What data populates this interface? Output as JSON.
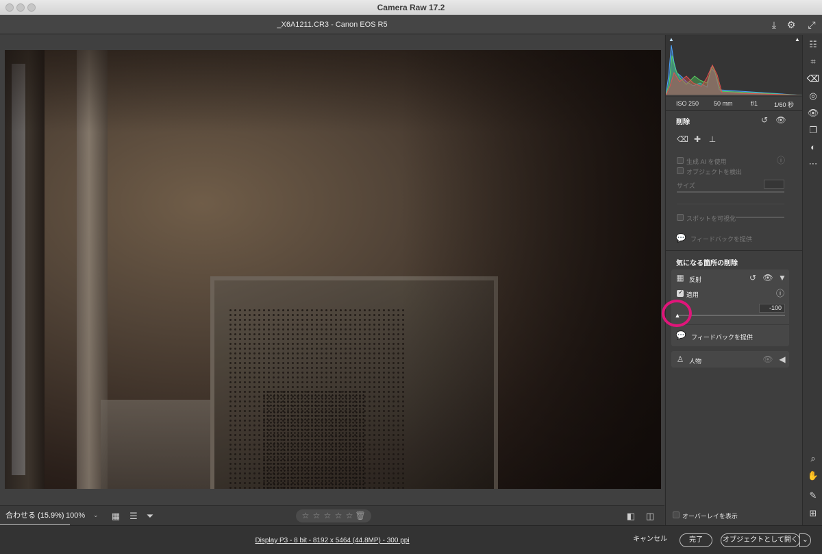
{
  "window": {
    "title": "Camera Raw 17.2"
  },
  "header": {
    "filename": "_X6A1211.CR3  -  Canon EOS R5"
  },
  "histogram": {
    "exif": {
      "iso": "ISO 250",
      "focal": "50 mm",
      "aperture": "f/1",
      "shutter": "1/60 秒"
    }
  },
  "remove": {
    "title": "削除",
    "use_generative_ai": "生成 AI を使用",
    "detect_objects": "オブジェクトを検出",
    "size_label": "サイズ",
    "visualize_spots": "スポットを可視化",
    "feedback": "フィードバックを提供"
  },
  "distractions": {
    "title": "気になる箇所の削除",
    "reflections": {
      "label": "反射",
      "apply_label": "適用",
      "amount": "-100",
      "feedback": "フィードバックを提供"
    },
    "people": {
      "label": "人物"
    }
  },
  "canvas_bottom": {
    "zoom_fit": "合わせる (15.9%)",
    "zoom_100": "100%",
    "overlay_label": "オーバーレイを表示",
    "stars": [
      "☆",
      "☆",
      "☆",
      "☆",
      "☆"
    ]
  },
  "footer": {
    "info": "Display P3 - 8 bit - 8192 x 5464 (44.8MP) - 300 ppi",
    "cancel": "キャンセル",
    "done": "完了",
    "open_object": "オブジェクトとして開く"
  },
  "colors": {
    "accent_ring": "#e0157a",
    "panel": "#3e3e3e",
    "background": "#3c3c3c"
  }
}
